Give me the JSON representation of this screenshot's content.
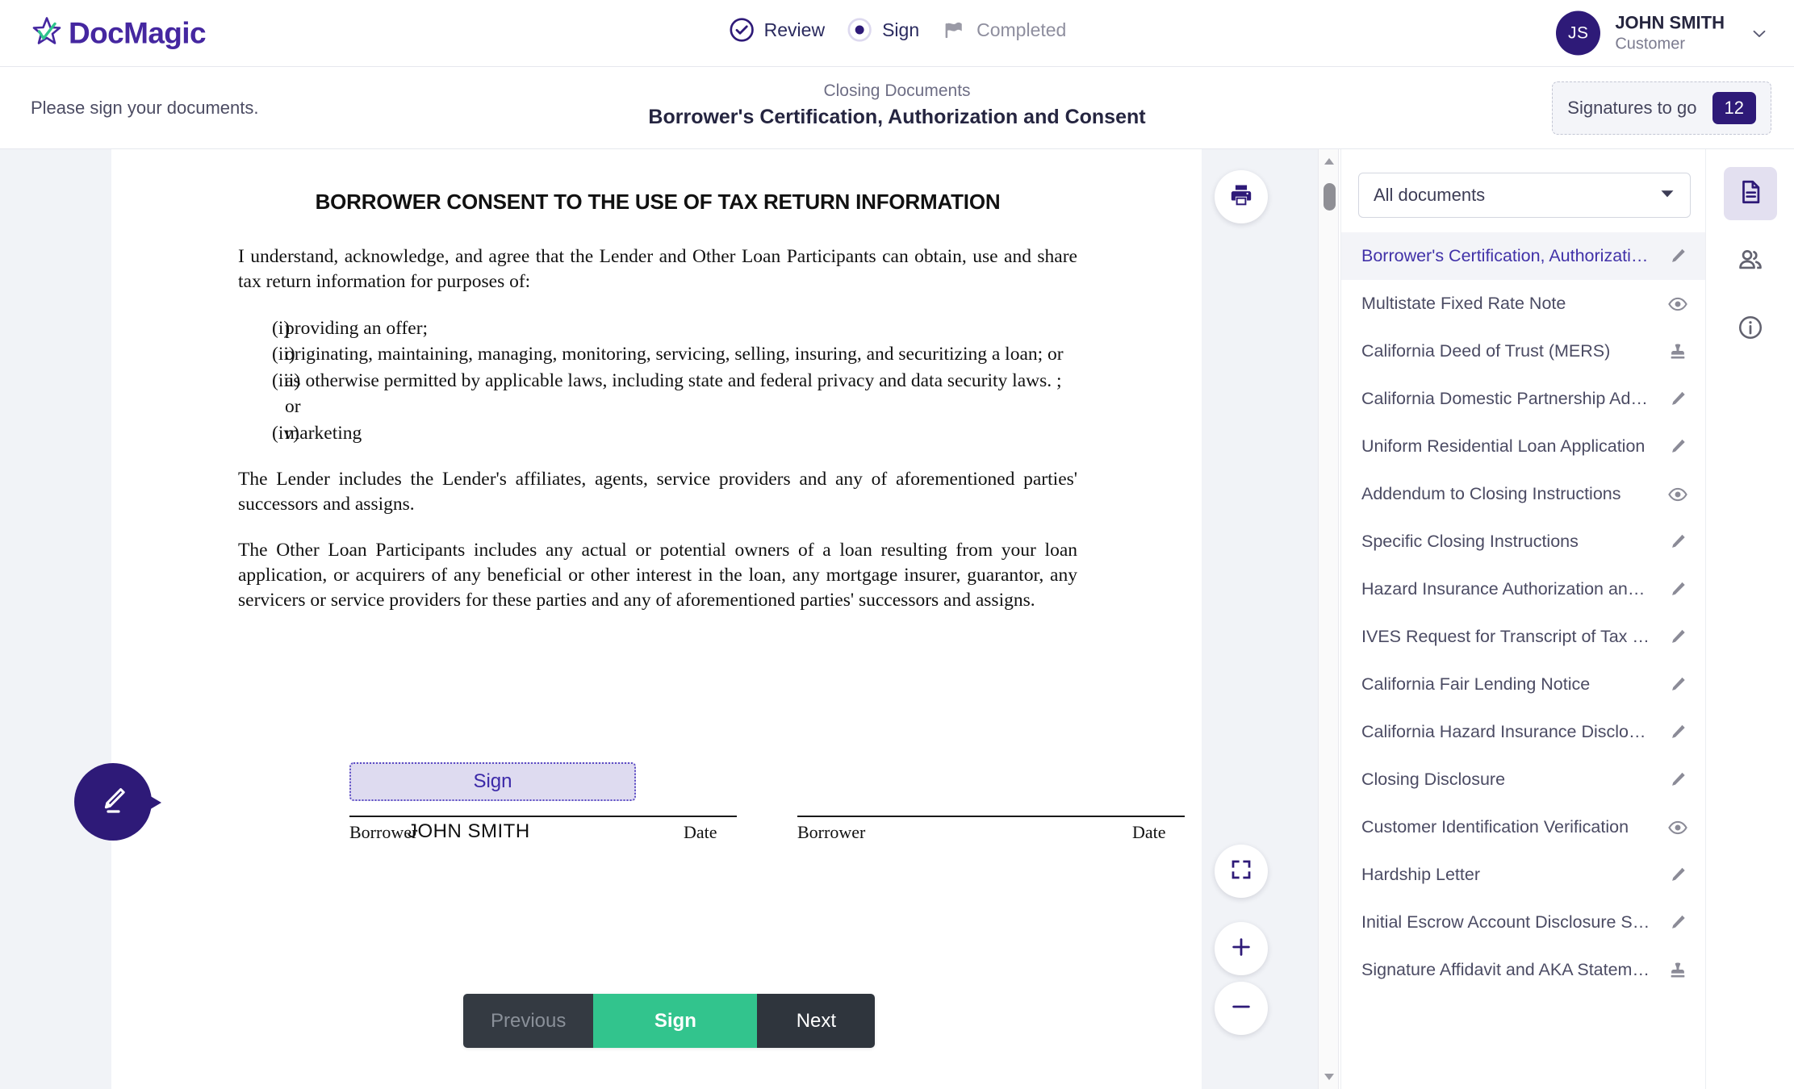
{
  "brand": {
    "name": "DocMagic"
  },
  "header": {
    "steps": [
      {
        "label": "Review",
        "icon": "check-circle-icon",
        "state": "done"
      },
      {
        "label": "Sign",
        "icon": "radio-filled-icon",
        "state": "current"
      },
      {
        "label": "Completed",
        "icon": "flag-icon",
        "state": "pending"
      }
    ],
    "user": {
      "initials": "JS",
      "name": "JOHN SMITH",
      "role": "Customer"
    }
  },
  "subheader": {
    "instruction": "Please sign your documents.",
    "kicker": "Closing Documents",
    "title": "Borrower's Certification, Authorization and Consent",
    "signatures_label": "Signatures to go",
    "signatures_count": "12"
  },
  "document": {
    "heading": "BORROWER CONSENT TO THE USE OF TAX RETURN INFORMATION",
    "paragraph1": "I understand, acknowledge, and agree that the Lender and Other Loan Participants can obtain, use and share tax return information for purposes of:",
    "list": [
      {
        "num": "(i)",
        "text": "providing an offer;"
      },
      {
        "num": "(ii)",
        "text": "originating, maintaining, managing, monitoring, servicing, selling, insuring, and securitizing a loan; or"
      },
      {
        "num": "(iii)",
        "text": "as otherwise permitted by applicable laws, including state and federal privacy and data security laws. ; or"
      },
      {
        "num": "(iv)",
        "text": "marketing"
      }
    ],
    "paragraph2": "The Lender includes the Lender's affiliates, agents, service providers and any of aforementioned parties' successors and assigns.",
    "paragraph3": "The Other Loan Participants includes any actual or potential owners of a loan resulting from your loan application, or acquirers of any beneficial or other interest in the loan, any mortgage insurer, guarantor, any servicers or service providers for these parties and any of aforementioned  parties' successors and assigns.",
    "signature": {
      "field_label": "Sign",
      "signed_name": "JOHN SMITH",
      "borrower_label_1": "Borrower",
      "date_label_1": "Date",
      "borrower_label_2": "Borrower",
      "date_label_2": "Date"
    }
  },
  "viewer_controls": {
    "print": "print-icon",
    "fit": "fit-screen-icon",
    "zoom_in": "zoom-in-icon",
    "zoom_out": "zoom-out-icon",
    "sign_fab": "pencil-sign-icon"
  },
  "docpanel": {
    "filter_value": "All documents",
    "items": [
      {
        "label": "Borrower's Certification, Authorization …",
        "icon": "pencil-icon",
        "selected": true
      },
      {
        "label": "Multistate Fixed Rate Note",
        "icon": "eye-icon",
        "selected": false
      },
      {
        "label": "California Deed of Trust (MERS)",
        "icon": "stamp-icon",
        "selected": false
      },
      {
        "label": "California Domestic Partnership Adden…",
        "icon": "pencil-icon",
        "selected": false
      },
      {
        "label": "Uniform Residential Loan Application",
        "icon": "pencil-icon",
        "selected": false
      },
      {
        "label": "Addendum to Closing Instructions",
        "icon": "eye-icon",
        "selected": false
      },
      {
        "label": "Specific Closing Instructions",
        "icon": "pencil-icon",
        "selected": false
      },
      {
        "label": "Hazard Insurance Authorization and Re…",
        "icon": "pencil-icon",
        "selected": false
      },
      {
        "label": "IVES Request for Transcript of Tax Ret…",
        "icon": "pencil-icon",
        "selected": false
      },
      {
        "label": "California Fair Lending Notice",
        "icon": "pencil-icon",
        "selected": false
      },
      {
        "label": "California Hazard Insurance Disclosure",
        "icon": "pencil-icon",
        "selected": false
      },
      {
        "label": "Closing Disclosure",
        "icon": "pencil-icon",
        "selected": false
      },
      {
        "label": "Customer Identification Verification",
        "icon": "eye-icon",
        "selected": false
      },
      {
        "label": "Hardship Letter",
        "icon": "pencil-icon",
        "selected": false
      },
      {
        "label": "Initial Escrow Account Disclosure State…",
        "icon": "pencil-icon",
        "selected": false
      },
      {
        "label": "Signature Affidavit and AKA Statement",
        "icon": "stamp-icon",
        "selected": false
      }
    ]
  },
  "rail": [
    {
      "icon": "document-icon",
      "active": true
    },
    {
      "icon": "people-icon",
      "active": false
    },
    {
      "icon": "info-icon",
      "active": false
    }
  ],
  "actions": {
    "previous": "Previous",
    "sign": "Sign",
    "next": "Next"
  },
  "colors": {
    "brand_purple": "#4527a0",
    "deep_purple": "#2e1a78",
    "accent_green": "#32c48d",
    "dark_slate": "#2f353d",
    "viewer_bg": "#f1f3f7"
  }
}
